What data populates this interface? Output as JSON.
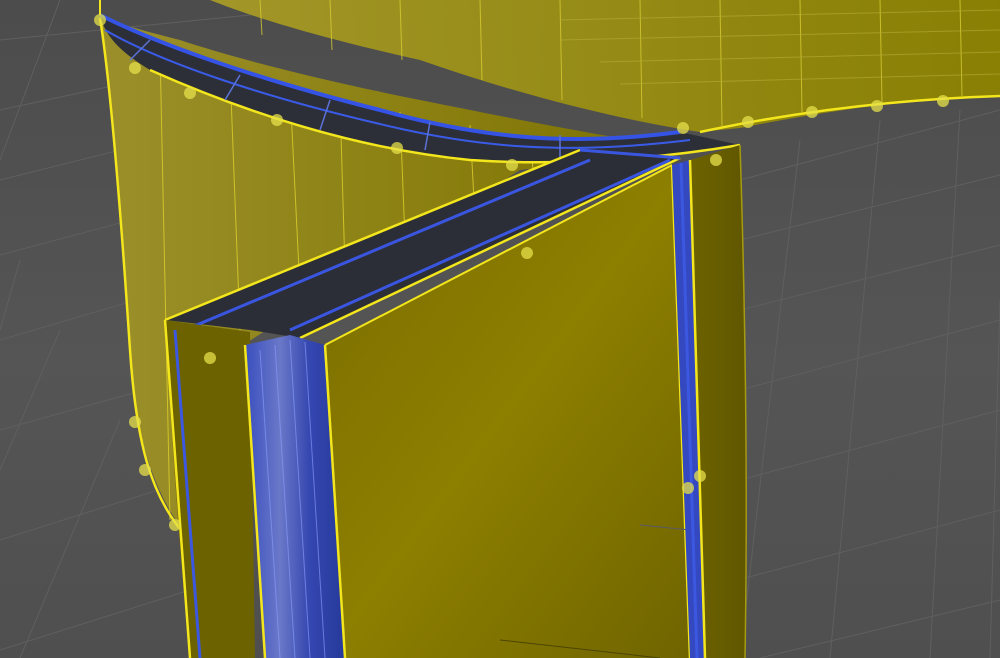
{
  "viewport": {
    "view": "3d-perspective-viewport",
    "background_color": "#4d4d4d",
    "grid_color": "#5e5e5e",
    "selection": {
      "object": "bent-wall-mesh",
      "selected": true,
      "selection_color": "#f0e21a",
      "face_color": "#8a7d00",
      "cap_color": "#2b2e36",
      "edge_highlight_color": "#2f55ff",
      "vertex_dot_color": "#e6e04a"
    }
  }
}
